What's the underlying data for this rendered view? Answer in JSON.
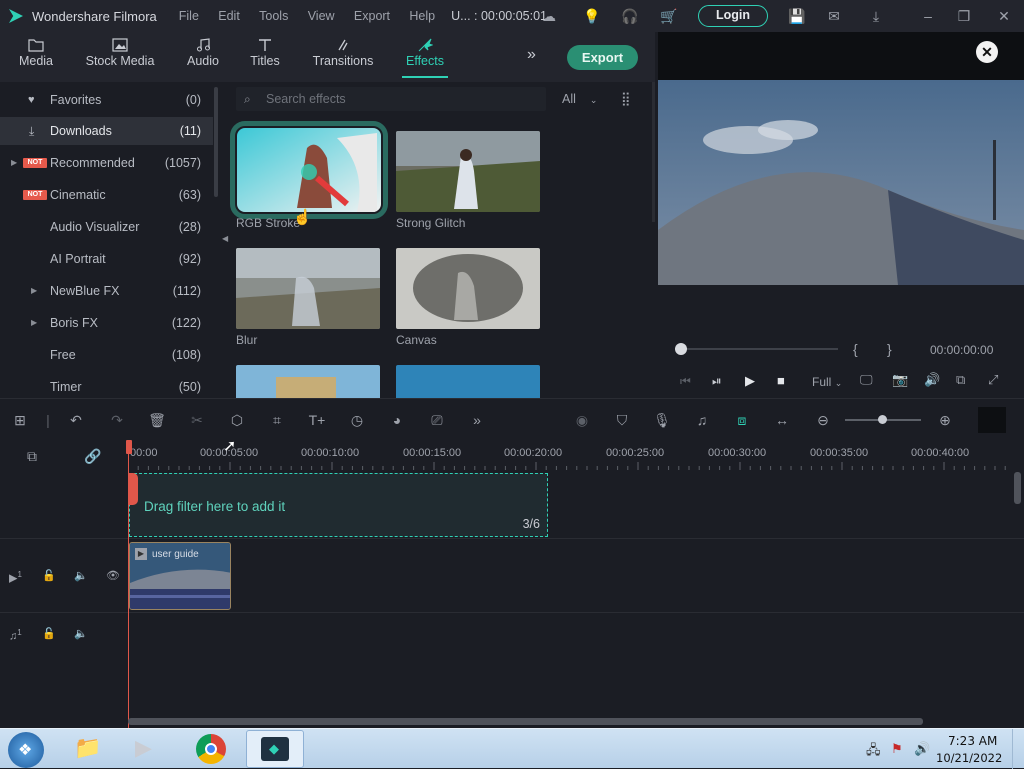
{
  "app": {
    "name": "Wondershare Filmora",
    "menu": [
      "File",
      "Edit",
      "Tools",
      "View",
      "Export",
      "Help"
    ],
    "project": "U... : 00:00:05:01",
    "login_label": "Login"
  },
  "tabs": [
    {
      "label": "Media",
      "icon": "folder-icon"
    },
    {
      "label": "Stock Media",
      "icon": "image-icon"
    },
    {
      "label": "Audio",
      "icon": "music-note-icon"
    },
    {
      "label": "Titles",
      "icon": "text-t-icon"
    },
    {
      "label": "Transitions",
      "icon": "transition-icon"
    },
    {
      "label": "Effects",
      "icon": "effects-icon",
      "active": true
    }
  ],
  "export_label": "Export",
  "sidebar": {
    "items": [
      {
        "name": "Favorites",
        "count": "(0)",
        "icon": "heart-icon"
      },
      {
        "name": "Downloads",
        "count": "(11)",
        "icon": "download-icon",
        "active": true
      },
      {
        "name": "Recommended",
        "count": "(1057)",
        "badge": "NOT",
        "arrow": true
      },
      {
        "name": "Cinematic",
        "count": "(63)",
        "badge": "NOT"
      },
      {
        "name": "Audio Visualizer",
        "count": "(28)"
      },
      {
        "name": "AI Portrait",
        "count": "(92)"
      },
      {
        "name": "NewBlue FX",
        "count": "(112)",
        "arrow": true
      },
      {
        "name": "Boris FX",
        "count": "(122)",
        "arrow": true
      },
      {
        "name": "Free",
        "count": "(108)"
      },
      {
        "name": "Timer",
        "count": "(50)"
      }
    ]
  },
  "search": {
    "placeholder": "Search effects"
  },
  "filter": {
    "value": "All"
  },
  "effects": [
    {
      "label": "RGB Stroke",
      "selected": true
    },
    {
      "label": "Strong Glitch"
    },
    {
      "label": "Blur"
    },
    {
      "label": "Canvas"
    }
  ],
  "preview": {
    "timecode": "00:00:00:00",
    "quality": "Full",
    "brackets_left": "{",
    "brackets_right": "}"
  },
  "timeline": {
    "ticks": [
      "00:00",
      "00:00:05:00",
      "00:00:10:00",
      "00:00:15:00",
      "00:00:20:00",
      "00:00:25:00",
      "00:00:30:00",
      "00:00:35:00",
      "00:00:40:00"
    ],
    "dropzone_text": "Drag filter here to add it",
    "dropzone_count": "3/6",
    "clip_label": "user guide",
    "video_track": "1",
    "audio_track": "1"
  },
  "taskbar": {
    "time": "7:23 AM",
    "date": "10/21/2022"
  },
  "colors": {
    "accent": "#2fd1b5",
    "export_bg": "#2a8f73",
    "playhead": "#e0574a",
    "badge": "#e65a4c"
  }
}
